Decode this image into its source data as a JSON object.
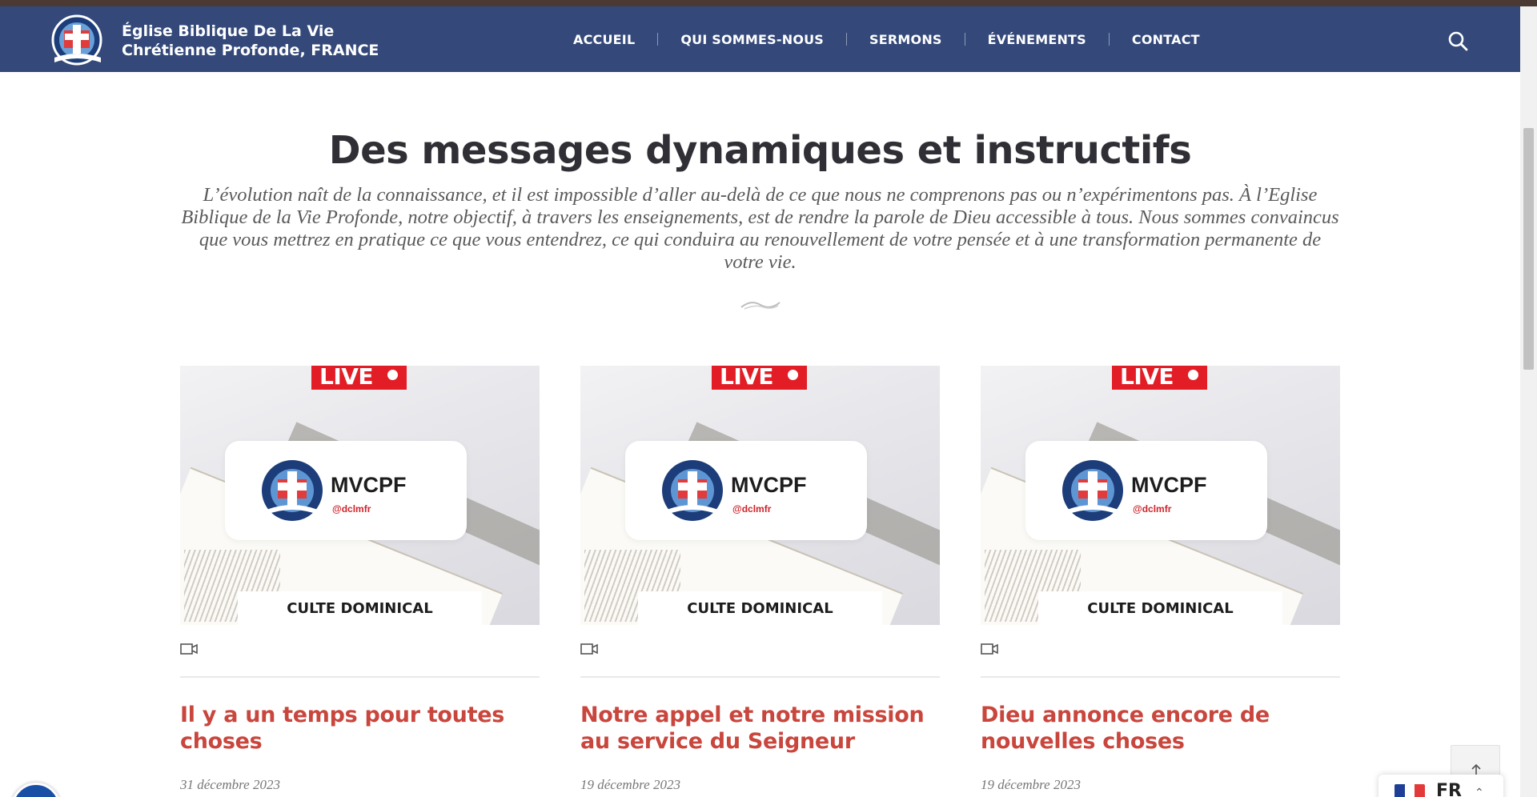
{
  "header": {
    "brand_line1": "Église Biblique De La Vie",
    "brand_line2": "Chrétienne Profonde, FRANCE",
    "logo_icon": "church-seal-logo",
    "nav": [
      {
        "label": "ACCUEIL"
      },
      {
        "label": "QUI SOMMES-NOUS"
      },
      {
        "label": "SERMONS"
      },
      {
        "label": "ÉVÉNEMENTS"
      },
      {
        "label": "CONTACT"
      }
    ],
    "search_icon": "search-icon",
    "bg_color": "#34497a"
  },
  "section": {
    "title": "Des messages dynamiques et instructifs",
    "intro": "L’évolution naît de la connaissance, et il est impossible d’aller au-delà de ce que nous ne comprenons pas ou n’expérimentons pas. À l’Eglise Biblique de la Vie Profonde, notre objectif, à travers les enseignements, est de rendre la parole de Dieu accessible à tous. Nous sommes convaincus que vous mettrez en pratique ce que vous entendrez, ce qui conduira au renouvellement de votre pensée et à une transformation permanente de votre vie."
  },
  "sermons": [
    {
      "thumb": {
        "live": "LIVE",
        "brand": "MVCPF",
        "handle": "@dclmfr",
        "label": "CULTE DOMINICAL"
      },
      "title": "Il y a un temps pour toutes choses",
      "date": "31 décembre 2023"
    },
    {
      "thumb": {
        "live": "LIVE",
        "brand": "MVCPF",
        "handle": "@dclmfr",
        "label": "CULTE DOMINICAL"
      },
      "title": "Notre appel et notre mission au service du Seigneur",
      "date": "19 décembre 2023"
    },
    {
      "thumb": {
        "live": "LIVE",
        "brand": "MVCPF",
        "handle": "@dclmfr",
        "label": "CULTE DOMINICAL"
      },
      "title": "Dieu annonce encore de nouvelles choses",
      "date": "19 décembre 2023"
    }
  ],
  "widgets": {
    "language_code": "FR",
    "back_to_top_icon": "arrow-up-icon",
    "accessibility_icon": "accessibility-icon"
  },
  "colors": {
    "title_red": "#c9463d",
    "live_red": "#e21d26"
  }
}
